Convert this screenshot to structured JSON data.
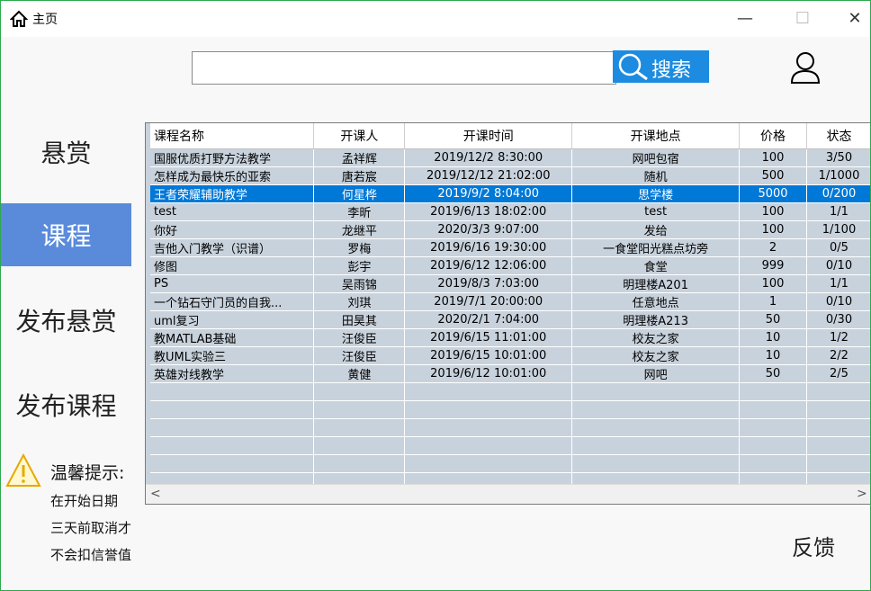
{
  "window": {
    "title": "主页",
    "min": "—",
    "max": "☐",
    "close": "✕"
  },
  "search": {
    "placeholder": "",
    "button_label": "搜索"
  },
  "sidebar": {
    "items": [
      {
        "label": "悬赏"
      },
      {
        "label": "课程"
      },
      {
        "label": "发布悬赏"
      },
      {
        "label": "发布课程"
      }
    ],
    "active_index": 1
  },
  "tip": {
    "title": "温馨提示:",
    "lines": [
      "在开始日期",
      "三天前取消才",
      "不会扣信誉值"
    ]
  },
  "table": {
    "headers": [
      "课程名称",
      "开课人",
      "开课时间",
      "开课地点",
      "价格",
      "状态"
    ],
    "rows": [
      [
        "国服优质打野方法教学",
        "孟祥辉",
        "2019/12/2 8:30:00",
        "网吧包宿",
        "100",
        "3/50"
      ],
      [
        "怎样成为最快乐的亚索",
        "唐若宸",
        "2019/12/12 21:02:00",
        "随机",
        "500",
        "1/1000"
      ],
      [
        "王者荣耀辅助教学",
        "何星桦",
        "2019/9/2 8:04:00",
        "思学楼",
        "5000",
        "0/200"
      ],
      [
        "test",
        "李昕",
        "2019/6/13 18:02:00",
        "test",
        "100",
        "1/1"
      ],
      [
        "你好",
        "龙继平",
        "2020/3/3 9:07:00",
        "发给",
        "100",
        "1/100"
      ],
      [
        "吉他入门教学（识谱）",
        "罗梅",
        "2019/6/16 19:30:00",
        "一食堂阳光糕点坊旁",
        "2",
        "0/5"
      ],
      [
        "修图",
        "彭宇",
        "2019/6/12 12:06:00",
        "食堂",
        "999",
        "0/10"
      ],
      [
        "PS",
        "吴雨锦",
        "2019/8/3 7:03:00",
        "明理楼A201",
        "100",
        "1/1"
      ],
      [
        "一个钻石守门员的自我...",
        "刘琪",
        "2019/7/1 20:00:00",
        "任意地点",
        "1",
        "0/10"
      ],
      [
        "uml复习",
        "田昊其",
        "2020/2/1 7:04:00",
        "明理楼A213",
        "50",
        "0/30"
      ],
      [
        "教MATLAB基础",
        "汪俊臣",
        "2019/6/15 11:01:00",
        "校友之家",
        "10",
        "1/2"
      ],
      [
        "教UML实验三",
        "汪俊臣",
        "2019/6/15 10:01:00",
        "校友之家",
        "10",
        "2/2"
      ],
      [
        "英雄对线教学",
        "黄健",
        "2019/6/12 10:01:00",
        "网吧",
        "50",
        "2/5"
      ]
    ],
    "selected_row": 2,
    "scroll_left": "<",
    "scroll_right": ">"
  },
  "feedback_label": "反馈",
  "colors": {
    "accent": "#1d8ce0",
    "sidebar_active": "#5a8bdb",
    "row_selected": "#0078d7",
    "row_bg": "#c8d2dc"
  }
}
